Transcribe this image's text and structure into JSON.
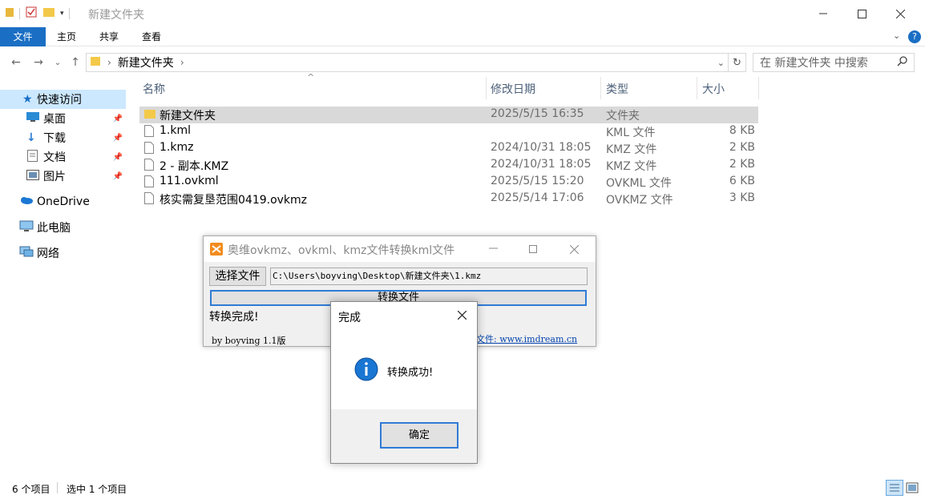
{
  "explorer": {
    "title": "新建文件夹",
    "ribbon_tabs": [
      "文件",
      "主页",
      "共享",
      "查看"
    ],
    "breadcrumb": "新建文件夹",
    "search_placeholder": "在 新建文件夹 中搜索",
    "sidebar": [
      {
        "label": "快速访问",
        "icon": "star-icon",
        "active": true,
        "pinned": false
      },
      {
        "label": "桌面",
        "icon": "desktop-icon",
        "active": false,
        "pinned": true
      },
      {
        "label": "下载",
        "icon": "download-icon",
        "active": false,
        "pinned": true
      },
      {
        "label": "文档",
        "icon": "document-icon",
        "active": false,
        "pinned": true
      },
      {
        "label": "图片",
        "icon": "picture-icon",
        "active": false,
        "pinned": true
      },
      {
        "label": "OneDrive",
        "icon": "cloud-icon",
        "active": false,
        "pinned": false
      },
      {
        "label": "此电脑",
        "icon": "computer-icon",
        "active": false,
        "pinned": false
      },
      {
        "label": "网络",
        "icon": "network-icon",
        "active": false,
        "pinned": false
      }
    ],
    "columns": {
      "name": "名称",
      "date": "修改日期",
      "type": "类型",
      "size": "大小"
    },
    "files": [
      {
        "name": "新建文件夹",
        "date": "2025/5/15 16:35",
        "type": "文件夹",
        "size": "",
        "folder": true,
        "selected": true
      },
      {
        "name": "1.kml",
        "date": "",
        "type": "KML 文件",
        "size": "8 KB",
        "folder": false,
        "selected": false
      },
      {
        "name": "1.kmz",
        "date": "2024/10/31 18:05",
        "type": "KMZ 文件",
        "size": "2 KB",
        "folder": false,
        "selected": false
      },
      {
        "name": "2 - 副本.KMZ",
        "date": "2024/10/31 18:05",
        "type": "KMZ 文件",
        "size": "2 KB",
        "folder": false,
        "selected": false
      },
      {
        "name": "111.ovkml",
        "date": "2025/5/15 15:20",
        "type": "OVKML 文件",
        "size": "6 KB",
        "folder": false,
        "selected": false
      },
      {
        "name": "核实需复垦范围0419.ovkmz",
        "date": "2025/5/14 17:06",
        "type": "OVKMZ 文件",
        "size": "3 KB",
        "folder": false,
        "selected": false
      }
    ],
    "status_count": "6 个项目",
    "status_selected": "选中 1 个项目"
  },
  "converter": {
    "title": "奥维ovkmz、ovkml、kmz文件转换kml文件",
    "choose_label": "选择文件",
    "path_value": "C:\\Users\\boyving\\Desktop\\新建文件夹\\1.kmz",
    "convert_label": "转换文件",
    "status": "转换完成!",
    "author": "by boyving 1.1版",
    "link_text": "文件: www.imdream.cn"
  },
  "dialog": {
    "title": "完成",
    "message": "转换成功!",
    "ok_label": "确定"
  },
  "colors": {
    "accent": "#1a6fc4",
    "selected_row": "#d9d9d9",
    "sidebar_active": "#cce8ff",
    "info_icon": "#1976d2"
  }
}
